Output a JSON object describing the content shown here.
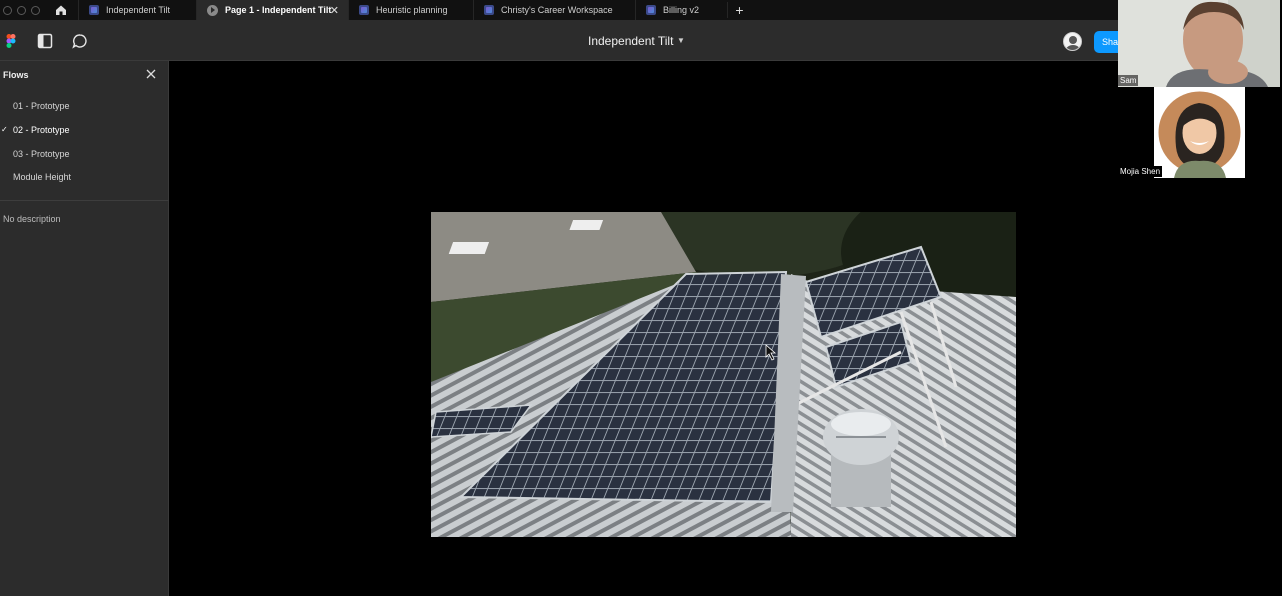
{
  "tabs": [
    {
      "label": "Independent Tilt",
      "icon": "figma-file-icon",
      "active": false
    },
    {
      "label": "Page 1 - Independent Tilt",
      "icon": "play-icon",
      "active": true
    },
    {
      "label": "Heuristic planning",
      "icon": "figma-file-icon",
      "active": false
    },
    {
      "label": "Christy's Career Workspace",
      "icon": "figma-file-icon",
      "active": false
    },
    {
      "label": "Billing v2",
      "icon": "figma-file-icon",
      "active": false
    }
  ],
  "tab_close_glyph": "✕",
  "new_tab_glyph": "+",
  "toolbar": {
    "document_title": "Independent Tilt",
    "share_label": "Share"
  },
  "sidebar": {
    "title": "Flows",
    "flows": [
      {
        "label": "01 - Prototype",
        "selected": false
      },
      {
        "label": "02 - Prototype",
        "selected": true
      },
      {
        "label": "03 - Prototype",
        "selected": false
      },
      {
        "label": "Module Height",
        "selected": false
      }
    ],
    "check_glyph": "✓",
    "description": "No description"
  },
  "participants": [
    {
      "name": "Sam"
    },
    {
      "name": "Mojia Shen"
    }
  ],
  "colors": {
    "share_button": "#0d99ff",
    "toolbar_bg": "#2c2c2c",
    "canvas_bg": "#000000"
  }
}
